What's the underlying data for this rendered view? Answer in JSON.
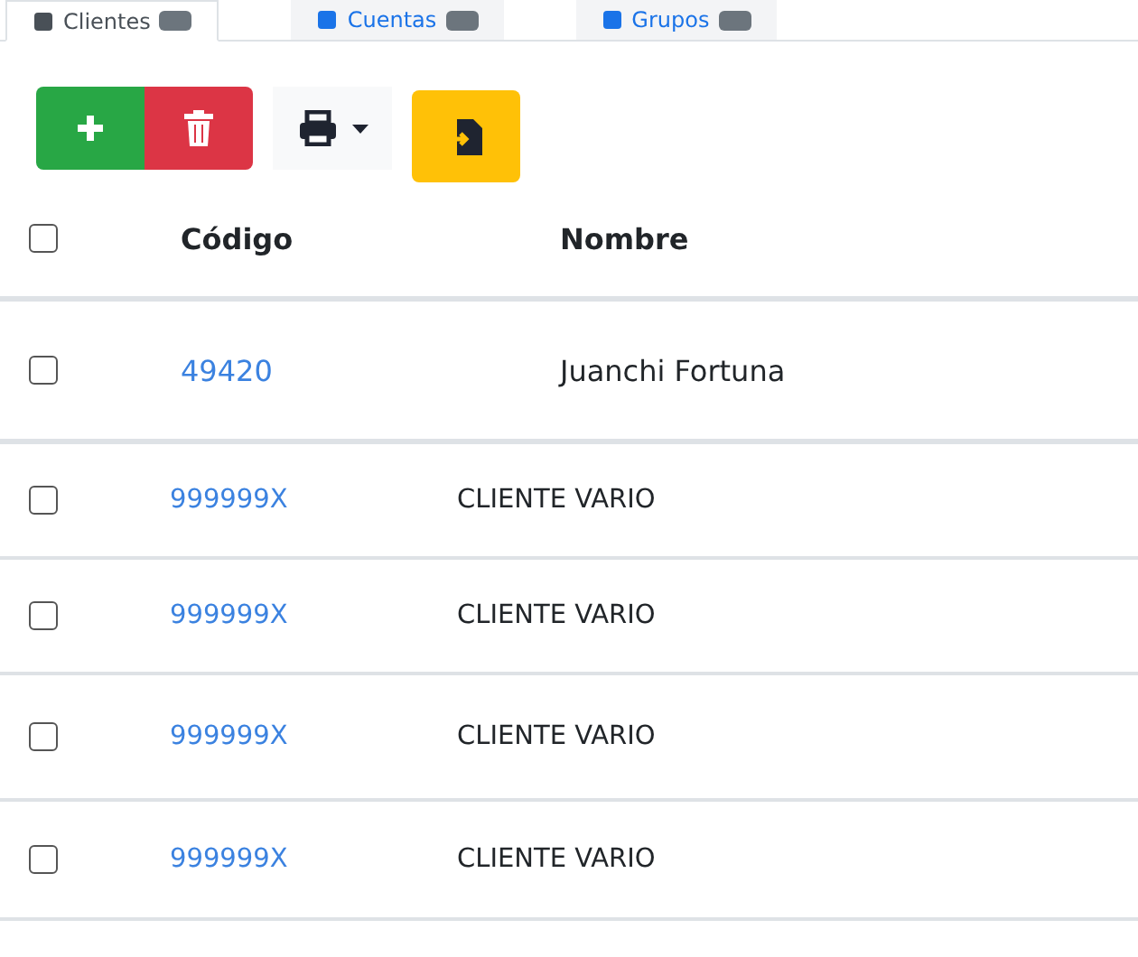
{
  "tabs": [
    {
      "label": "Clientes",
      "selected": true
    },
    {
      "label": "Cuentas",
      "selected": false
    },
    {
      "label": "Grupos",
      "selected": false
    }
  ],
  "toolbar": {
    "print_menu": {
      "expanded": false
    }
  },
  "table": {
    "columns": [
      "Código",
      "Nombre"
    ],
    "select_all": {
      "checked": false
    },
    "rows": [
      {
        "code": "49420",
        "name": "Juanchi Fortuna",
        "checked": false
      }
    ]
  },
  "list": {
    "rows": [
      {
        "code": "999999X",
        "name": "CLIENTE VARIO",
        "checked": false
      },
      {
        "code": "999999X",
        "name": "CLIENTE VARIO",
        "checked": false
      },
      {
        "code": "999999X",
        "name": "CLIENTE VARIO",
        "checked": false
      },
      {
        "code": "999999X",
        "name": "CLIENTE VARIO",
        "checked": false
      }
    ]
  }
}
